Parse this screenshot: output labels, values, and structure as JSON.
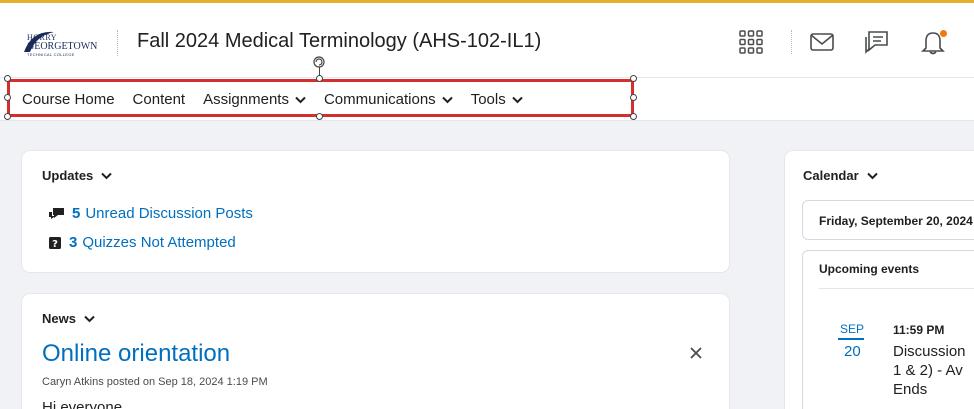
{
  "header": {
    "logo": {
      "line1": "HORRY",
      "line2": "GEORGETOWN",
      "line3": "TECHNICAL COLLEGE"
    },
    "course_title": "Fall 2024 Medical Terminology (AHS-102-IL1)",
    "icons": [
      "apps-grid-icon",
      "mail-icon",
      "discussions-icon",
      "bell-icon"
    ],
    "accent_color": "#e6b02e",
    "notification_dot_color": "#f2790f"
  },
  "navbar": {
    "items": [
      {
        "label": "Course Home",
        "dropdown": false
      },
      {
        "label": "Content",
        "dropdown": false
      },
      {
        "label": "Assignments",
        "dropdown": true
      },
      {
        "label": "Communications",
        "dropdown": true
      },
      {
        "label": "Tools",
        "dropdown": true
      }
    ],
    "selection_color": "#d32f2f"
  },
  "updates": {
    "title": "Updates",
    "items": [
      {
        "icon": "discussion-icon",
        "count": "5",
        "label": "Unread Discussion Posts"
      },
      {
        "icon": "quiz-icon",
        "count": "3",
        "label": "Quizzes Not Attempted"
      }
    ]
  },
  "news": {
    "title": "News",
    "item_title": "Online orientation",
    "meta": "Caryn Atkins posted on Sep 18, 2024 1:19 PM",
    "body": "Hi everyone,"
  },
  "calendar": {
    "title": "Calendar",
    "date": "Friday, September 20, 2024",
    "upcoming_title": "Upcoming events",
    "event": {
      "month": "SEP",
      "day": "20",
      "time": "11:59 PM",
      "title": "Discussion\n1 & 2) - Av\nEnds"
    }
  },
  "link_color": "#006fbf"
}
